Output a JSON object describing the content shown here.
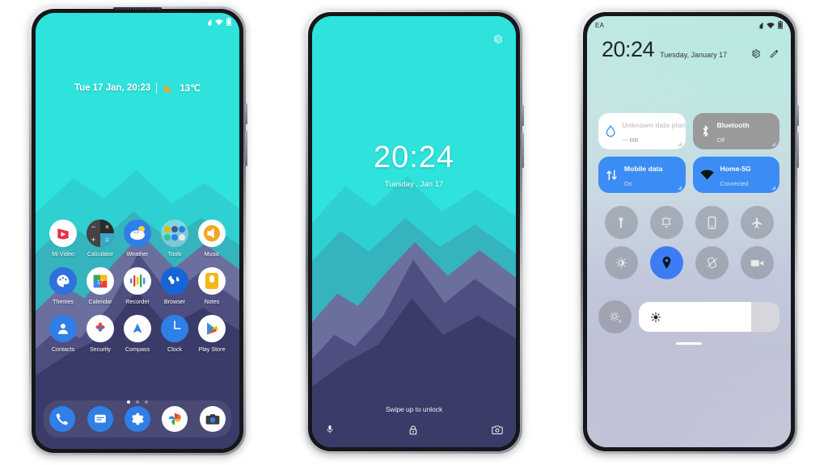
{
  "phone1": {
    "name": "home-screen",
    "statusbar": {
      "signal_icon": "signal-icon",
      "wifi_icon": "wifi-icon",
      "battery_icon": "battery-icon"
    },
    "widget": {
      "datetime": "Tue 17 Jan, 20:23",
      "weather_icon": "moon-icon",
      "temperature": "13℃"
    },
    "apps": [
      [
        {
          "label": "Mi Video",
          "icon": "mi-video-icon"
        },
        {
          "label": "Calculator",
          "icon": "calculator-icon"
        },
        {
          "label": "Weather",
          "icon": "weather-icon"
        },
        {
          "label": "Tools",
          "icon": "tools-folder-icon"
        },
        {
          "label": "Music",
          "icon": "music-icon"
        }
      ],
      [
        {
          "label": "Themes",
          "icon": "themes-icon"
        },
        {
          "label": "Calendar",
          "icon": "calendar-icon"
        },
        {
          "label": "Recorder",
          "icon": "recorder-icon"
        },
        {
          "label": "Browser",
          "icon": "browser-icon"
        },
        {
          "label": "Notes",
          "icon": "notes-icon"
        }
      ],
      [
        {
          "label": "Contacts",
          "icon": "contacts-icon"
        },
        {
          "label": "Security",
          "icon": "security-icon"
        },
        {
          "label": "Compass",
          "icon": "compass-icon"
        },
        {
          "label": "Clock",
          "icon": "clock-icon"
        },
        {
          "label": "Play Store",
          "icon": "play-store-icon"
        }
      ]
    ],
    "page_dots": {
      "count": 3,
      "active": 1
    },
    "dock": [
      {
        "label": "Phone",
        "icon": "phone-icon"
      },
      {
        "label": "Messages",
        "icon": "messages-icon"
      },
      {
        "label": "Settings",
        "icon": "settings-gear-icon"
      },
      {
        "label": "Photos",
        "icon": "photos-icon"
      },
      {
        "label": "Camera",
        "icon": "camera-icon"
      }
    ]
  },
  "phone2": {
    "name": "lock-screen",
    "settings_icon": "gear-icon",
    "time": "20:24",
    "date": "Tuesday , Jan 17",
    "hint": "Swipe up to unlock",
    "shortcuts": [
      {
        "icon": "microphone-icon"
      },
      {
        "icon": "lock-icon"
      },
      {
        "icon": "camera-icon"
      }
    ]
  },
  "phone3": {
    "name": "quick-settings-panel",
    "statusbar": {
      "carrier": "EA",
      "signal_icon": "signal-icon",
      "wifi_icon": "wifi-icon",
      "battery_icon": "battery-icon"
    },
    "time": "20:24",
    "date": "Tuesday, January 17",
    "header_icons": [
      {
        "icon": "settings-gear-icon"
      },
      {
        "icon": "edit-pencil-icon"
      }
    ],
    "big_tiles": [
      {
        "title": "Unknown data plan",
        "subtitle": "--- MB",
        "icon": "data-usage-drop-icon",
        "style": "white"
      },
      {
        "title": "Bluetooth",
        "subtitle": "Off",
        "icon": "bluetooth-icon",
        "style": "gray"
      },
      {
        "title": "Mobile data",
        "subtitle": "On",
        "icon": "mobile-data-icon",
        "style": "blue"
      },
      {
        "title": "Home-5G",
        "subtitle": "Connected",
        "icon": "wifi-icon",
        "style": "blue"
      }
    ],
    "mini_tiles": [
      {
        "icon": "flashlight-icon",
        "active": false
      },
      {
        "icon": "ring-bell-icon",
        "active": false
      },
      {
        "icon": "vibrate-phone-icon",
        "active": false
      },
      {
        "icon": "airplane-icon",
        "active": false
      },
      {
        "icon": "dark-mode-icon",
        "active": false
      },
      {
        "icon": "location-pin-icon",
        "active": true
      },
      {
        "icon": "rotation-lock-icon",
        "active": false
      },
      {
        "icon": "screen-record-icon",
        "active": false
      }
    ],
    "brightness": {
      "icon": "auto-brightness-icon",
      "slider_icon": "brightness-sun-icon",
      "level": 80
    }
  },
  "colors": {
    "sky": "#2ee3dc",
    "mountain_1": "#2fd6d2",
    "mountain_2": "#36b8bd",
    "mountain_3": "#6b6f9e",
    "mountain_4": "#4a4b7c",
    "mountain_5": "#3a3a66",
    "accent_blue": "#3c8cf5",
    "tile_gray": "#9a9a9a",
    "moon_orange": "#f5a623"
  }
}
